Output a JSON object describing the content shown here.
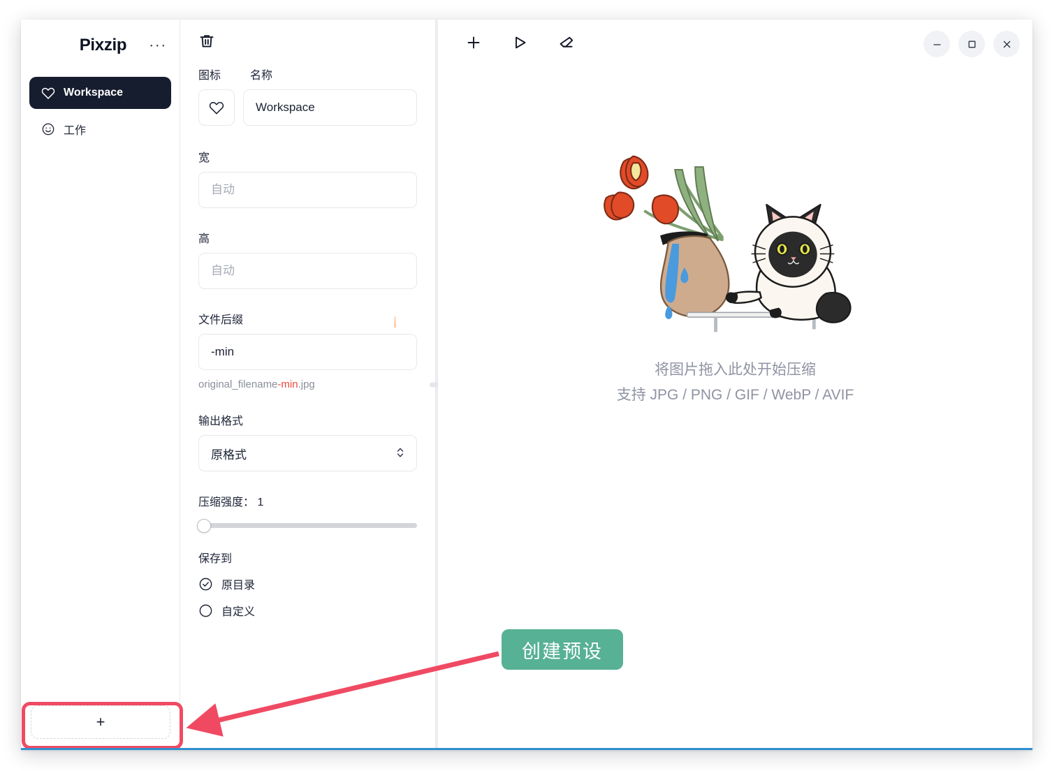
{
  "window": {
    "app_title": "Pixzip",
    "controls": {
      "minimize": "minimize-icon",
      "maximize": "maximize-icon",
      "close": "close-icon"
    }
  },
  "sidebar": {
    "more_label": "···",
    "items": [
      {
        "label": "Workspace",
        "icon": "heart-icon",
        "active": true
      },
      {
        "label": "工作",
        "icon": "smiley-icon",
        "active": false
      }
    ],
    "add_button_label": "+"
  },
  "settings": {
    "toolbar": {
      "delete_icon": "trash-icon"
    },
    "icon_label": "图标",
    "name_label": "名称",
    "name_value": "Workspace",
    "preset_icon": "heart-icon",
    "width_label": "宽",
    "width_placeholder": "自动",
    "width_value": "",
    "height_label": "高",
    "height_placeholder": "自动",
    "height_value": "",
    "suffix_label": "文件后缀",
    "suffix_value": "-min",
    "suffix_preview_prefix": "original_filename",
    "suffix_preview_highlight": "-min",
    "suffix_preview_ext": ".jpg",
    "format_label": "输出格式",
    "format_value": "原格式",
    "quality_label": "压缩强度： 1",
    "quality_value": 1,
    "quality_min": 1,
    "quality_max": 100,
    "save_to_label": "保存到",
    "save_options": [
      {
        "label": "原目录",
        "selected": true
      },
      {
        "label": "自定义",
        "selected": false
      }
    ]
  },
  "main": {
    "toolbar": [
      {
        "name": "add-files-button",
        "icon": "plus-icon"
      },
      {
        "name": "start-compress-button",
        "icon": "play-icon"
      },
      {
        "name": "clear-list-button",
        "icon": "eraser-icon"
      }
    ],
    "drop_zone": {
      "illustration": "cat-and-vase-illustration",
      "line1": "将图片拖入此处开始压缩",
      "line2": "支持 JPG / PNG / GIF / WebP / AVIF"
    }
  },
  "annotation": {
    "badge_text": "创建预设",
    "badge_color": "#57b194",
    "arrow_color": "#f04a63",
    "highlight_color": "#f04a63"
  }
}
